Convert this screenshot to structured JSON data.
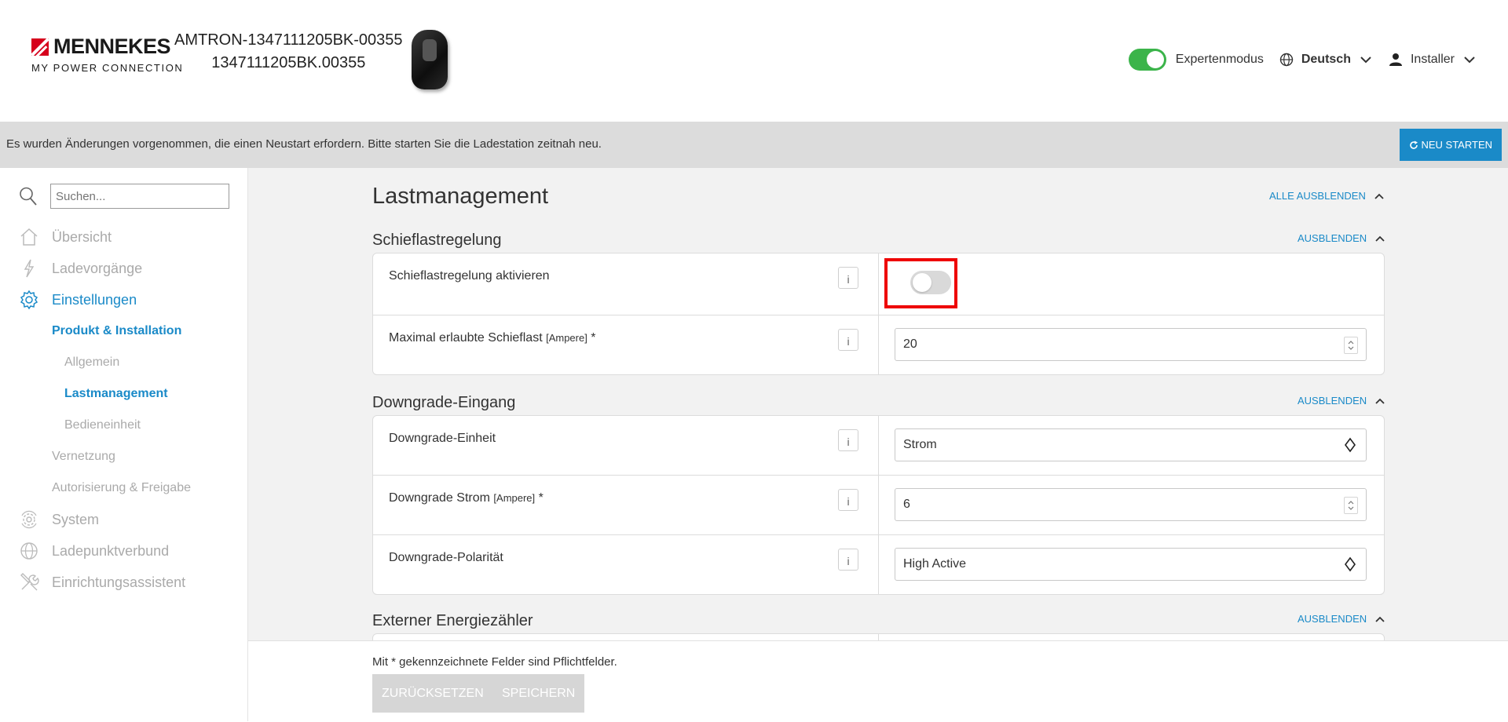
{
  "header": {
    "brand_name": "MENNEKES",
    "brand_tagline": "MY POWER CONNECTION",
    "device_name": "AMTRON-1347111205BK-00355",
    "device_serial": "1347111205BK.00355",
    "expert_mode_label": "Expertenmodus",
    "expert_mode_on": true,
    "language": "Deutsch",
    "user": "Installer"
  },
  "banner": {
    "message": "Es wurden Änderungen vorgenommen, die einen Neustart erfordern. Bitte starten Sie die Ladestation zeitnah neu.",
    "restart_label": "NEU STARTEN"
  },
  "sidebar": {
    "search_placeholder": "Suchen...",
    "items": [
      {
        "label": "Übersicht"
      },
      {
        "label": "Ladevorgänge"
      },
      {
        "label": "Einstellungen"
      },
      {
        "label": "Produkt & Installation"
      },
      {
        "label": "Allgemein"
      },
      {
        "label": "Lastmanagement"
      },
      {
        "label": "Bedieneinheit"
      },
      {
        "label": "Vernetzung"
      },
      {
        "label": "Autorisierung & Freigabe"
      },
      {
        "label": "System"
      },
      {
        "label": "Ladepunktverbund"
      },
      {
        "label": "Einrichtungsassistent"
      }
    ]
  },
  "main": {
    "title": "Lastmanagement",
    "collapse_all_label": "ALLE AUSBLENDEN",
    "hide_label": "AUSBLENDEN",
    "sections": [
      {
        "title": "Schieflastregelung",
        "rows": [
          {
            "label": "Schieflastregelung aktivieren",
            "info": "i",
            "toggle_on": false
          },
          {
            "label": "Maximal erlaubte Schieflast",
            "unit": "[Ampere]",
            "required": "*",
            "info": "i",
            "value": "20"
          }
        ]
      },
      {
        "title": "Downgrade-Eingang",
        "rows": [
          {
            "label": "Downgrade-Einheit",
            "info": "i",
            "value": "Strom"
          },
          {
            "label": "Downgrade Strom",
            "unit": "[Ampere]",
            "required": "*",
            "info": "i",
            "value": "6"
          },
          {
            "label": "Downgrade-Polarität",
            "info": "i",
            "value": "High Active"
          }
        ]
      },
      {
        "title": "Externer Energiezähler"
      }
    ]
  },
  "footer": {
    "required_note": "Mit * gekennzeichnete Felder sind Pflichtfelder.",
    "reset_label": "ZURÜCKSETZEN",
    "save_label": "SPEICHERN"
  },
  "colors": {
    "accent": "#1a8ac8",
    "brand_red": "#d6001c",
    "toggle_on": "#3bb44a",
    "highlight": "#ee0000"
  }
}
